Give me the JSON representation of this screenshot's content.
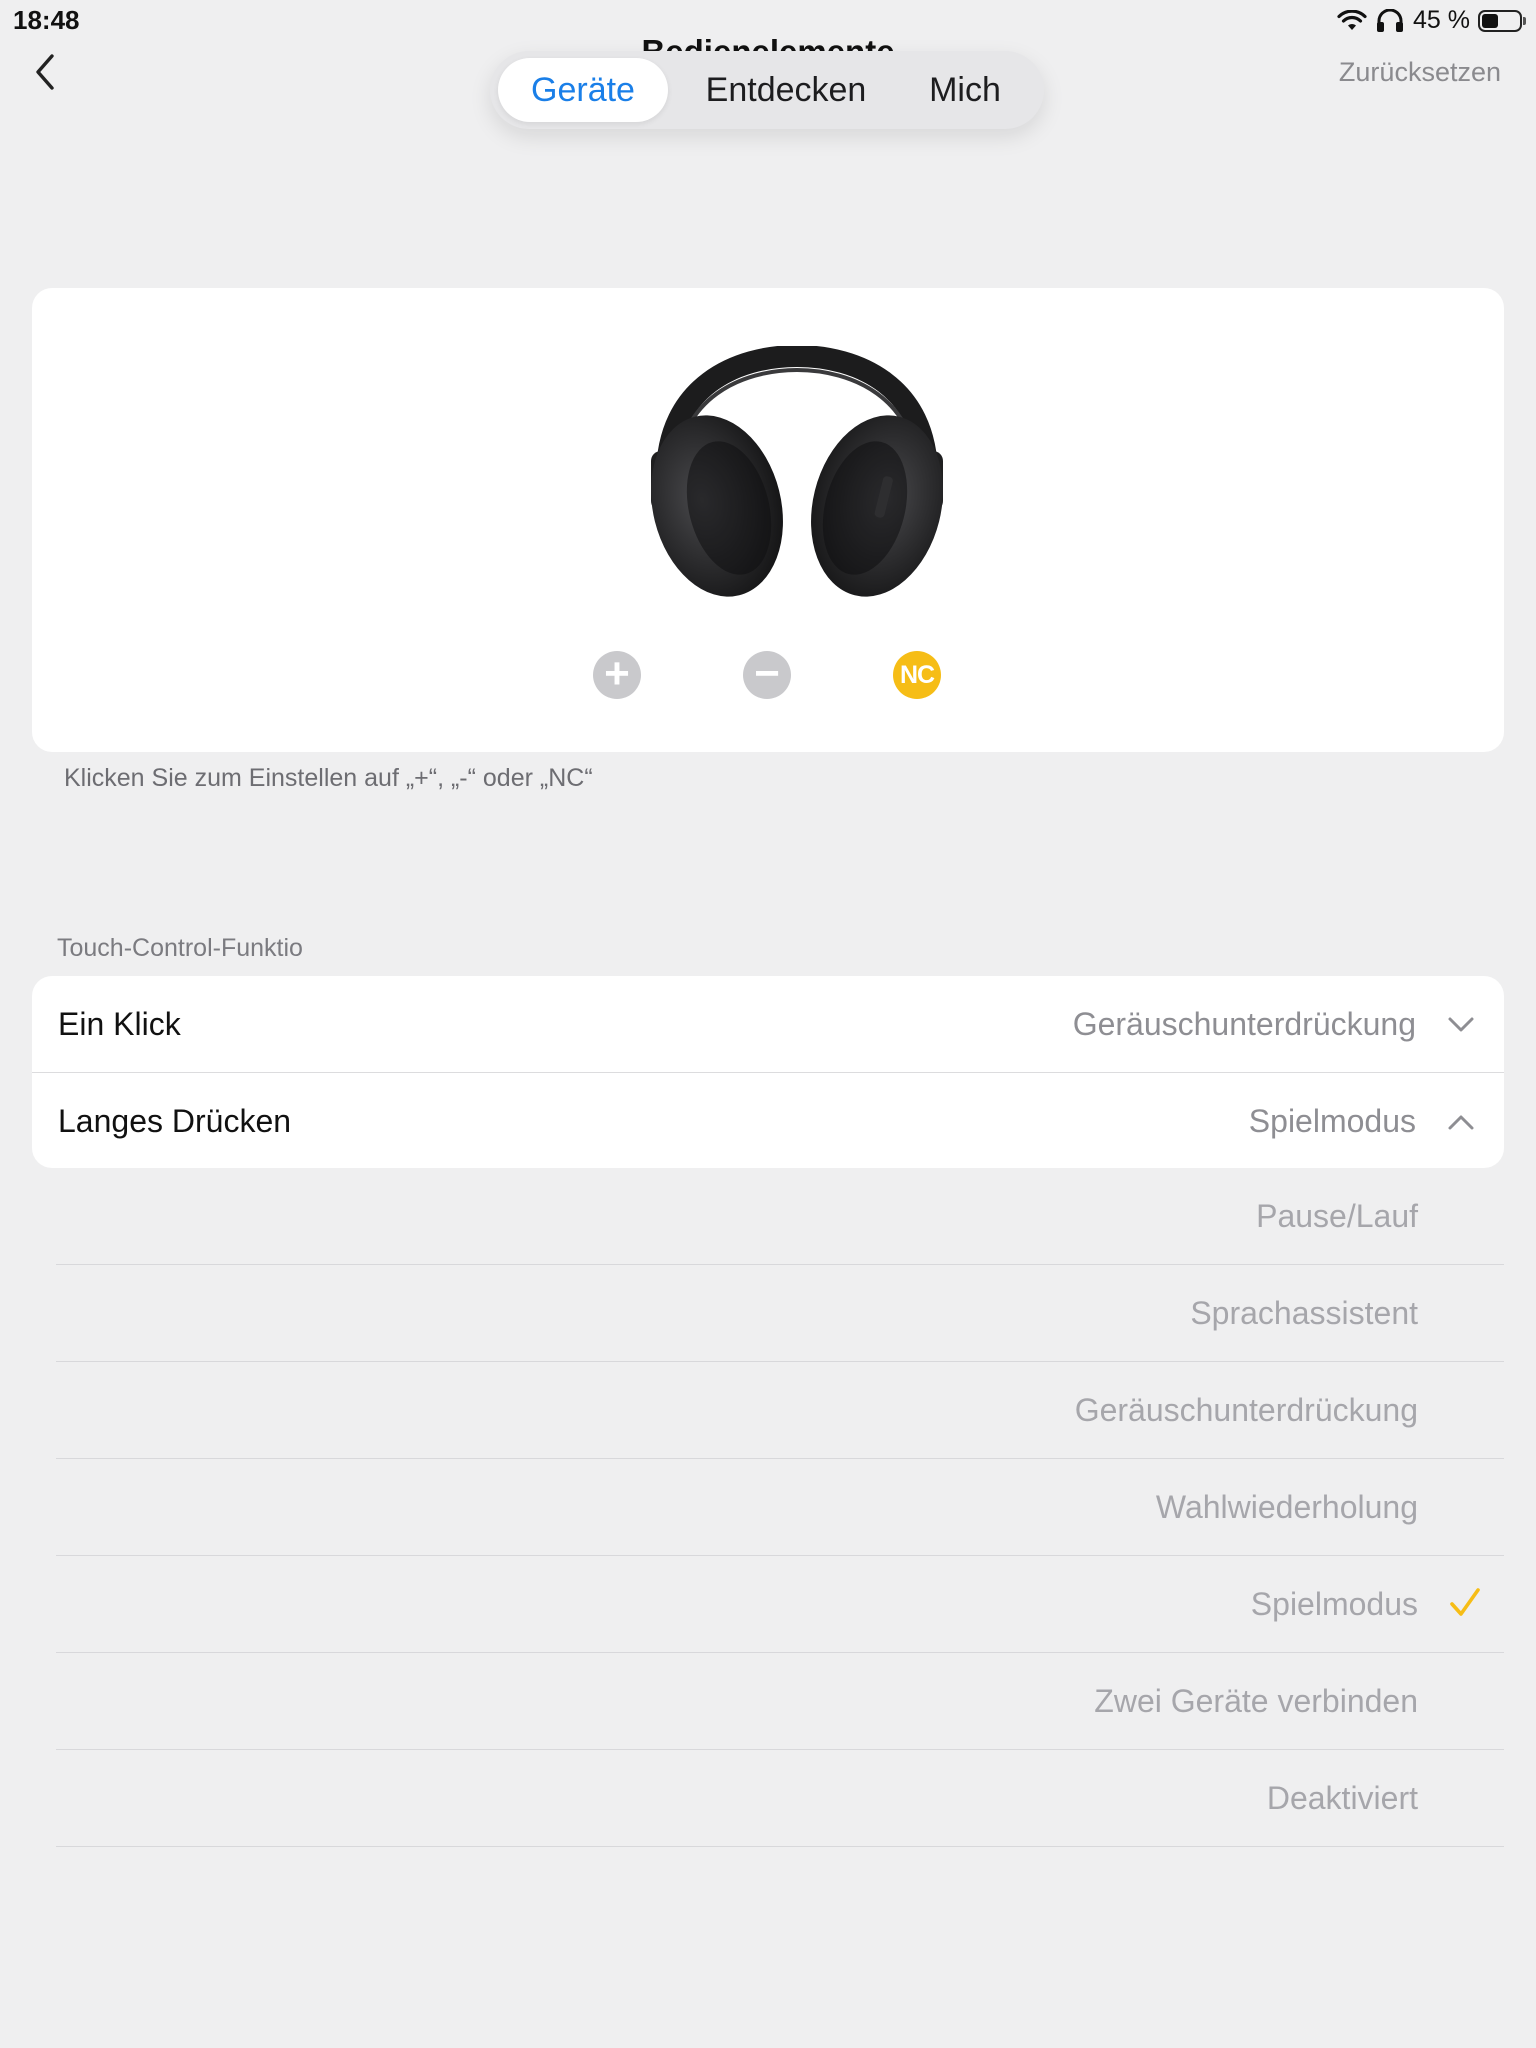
{
  "status_bar": {
    "time": "18:48",
    "battery_text": "45 %",
    "battery_level": 0.45,
    "icons": [
      "wifi-icon",
      "headphones-icon",
      "battery-icon"
    ]
  },
  "nav": {
    "title": "Bedienelemente",
    "reset_label": "Zurücksetzen",
    "back_icon": "chevron-left-icon",
    "tabs": [
      {
        "label": "Geräte",
        "active": true
      },
      {
        "label": "Entdecken",
        "active": false
      },
      {
        "label": "Mich",
        "active": false
      }
    ]
  },
  "device": {
    "image": "headphones-image",
    "controls": [
      {
        "label": "+",
        "icon": "plus-icon"
      },
      {
        "label": "−",
        "icon": "minus-icon"
      },
      {
        "label": "NC",
        "icon": "noise-cancel-icon"
      }
    ],
    "hint": "Klicken Sie zum Einstellen auf „+“, „-“ oder „NC“"
  },
  "touch_control": {
    "section_title": "Touch-Control-Funktio",
    "rows": [
      {
        "label": "Ein Klick",
        "value": "Geräuschunterdrückung",
        "expanded": false
      },
      {
        "label": "Langes Drücken",
        "value": "Spielmodus",
        "expanded": true
      }
    ],
    "options": [
      "Pause/Lauf",
      "Sprachassistent",
      "Geräuschunterdrückung",
      "Wahlwiederholung",
      "Spielmodus",
      "Zwei Geräte verbinden",
      "Deaktiviert"
    ],
    "selected_option": "Spielmodus"
  },
  "colors": {
    "accent_blue": "#1a7fe8",
    "accent_yellow": "#f6bd16",
    "background": "#efeff0"
  }
}
